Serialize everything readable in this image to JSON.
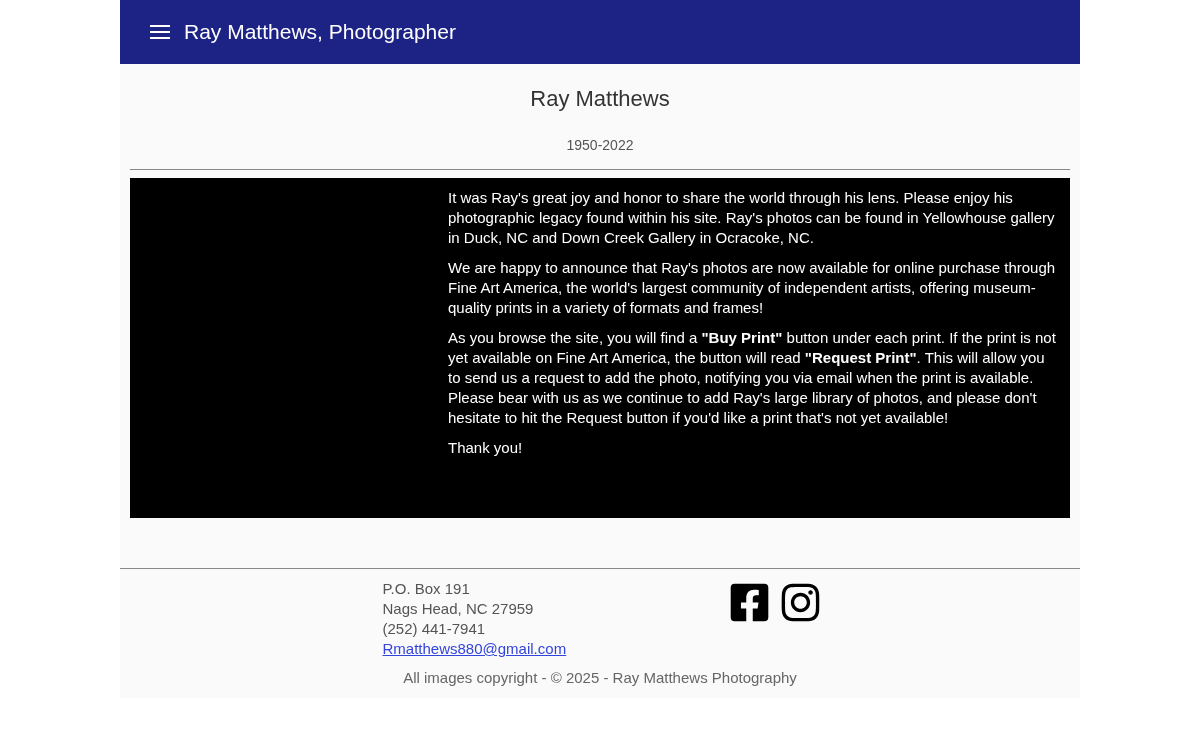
{
  "header": {
    "title": "Ray Matthews, Photographer"
  },
  "profile": {
    "name": "Ray Matthews",
    "years": "1950-2022"
  },
  "intro": {
    "paragraphs": [
      "It was Ray's great joy and honor to share the world through his lens. Please enjoy his photographic legacy found within his site. Ray's photos can be found in Yellowhouse gallery in Duck, NC and Down Creek Gallery in Ocracoke, NC.",
      "We are happy to announce that Ray's photos are now available for online purchase through Fine Art America, the world's largest community of independent artists, offering museum-quality prints in a variety of formats and frames!",
      "As you browse the site, you will find a **\"Buy Print\"** button under each print. If the print is not yet available on Fine Art America, the button will read **\"Request Print\"**. This will allow you to send us a request to add the photo, notifying you via email when the print is available. Please bear with us as we continue to add Ray's large library of photos, and please don't hesitate to hit the Request button if you'd like a print that's not yet available!",
      "Thank you!"
    ]
  },
  "footer": {
    "address": [
      "P.O. Box 191",
      "Nags Head, NC 27959",
      "(252) 441-7941"
    ],
    "email": "Rmatthews880@gmail.com",
    "social": [
      {
        "kind": "facebook"
      },
      {
        "kind": "instagram"
      }
    ],
    "copyright": "All images copyright - © 2025 - Ray Matthews Photography"
  }
}
